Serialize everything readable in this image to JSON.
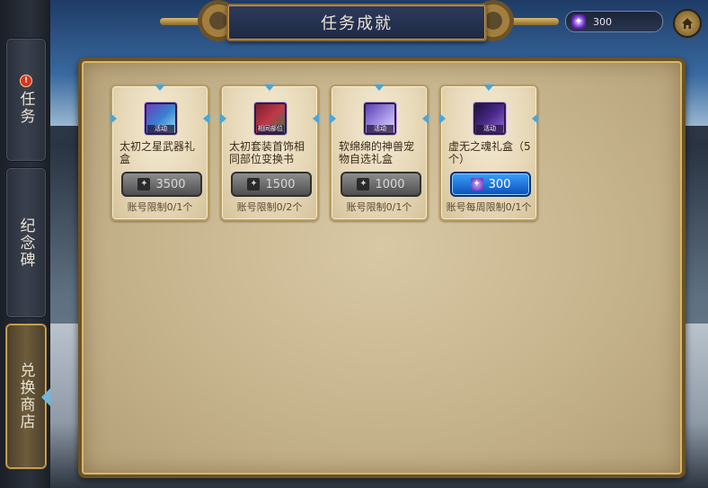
{
  "header": {
    "title": "任务成就"
  },
  "currency": {
    "amount": "300",
    "icon": "crystal-icon",
    "color": "#7a3cd6"
  },
  "sidebar": {
    "tabs": [
      {
        "label": "任务",
        "alert": "!",
        "active": false
      },
      {
        "label": "纪念碑",
        "active": false
      },
      {
        "label": "兑换商店",
        "active": true
      }
    ]
  },
  "shop": {
    "items": [
      {
        "name": "太初之星武器礼盒",
        "icon": "weapon-chest-icon",
        "icon_tag": "活动",
        "price": "3500",
        "limit": "账号限制0/1个",
        "available": false
      },
      {
        "name": "太初套装首饰相同部位变换书",
        "icon": "accessory-book-icon",
        "icon_tag": "相同部位",
        "price": "1500",
        "limit": "账号限制0/2个",
        "available": false
      },
      {
        "name": "软绵绵的神兽宠物自选礼盒",
        "icon": "pet-box-icon",
        "icon_tag": "活动",
        "price": "1000",
        "limit": "账号限制0/1个",
        "available": false
      },
      {
        "name": "虚无之魂礼盒（5个）",
        "icon": "soul-box-icon",
        "icon_tag": "活动",
        "price": "300",
        "limit": "账号每周限制0/1个",
        "available": true
      }
    ]
  }
}
